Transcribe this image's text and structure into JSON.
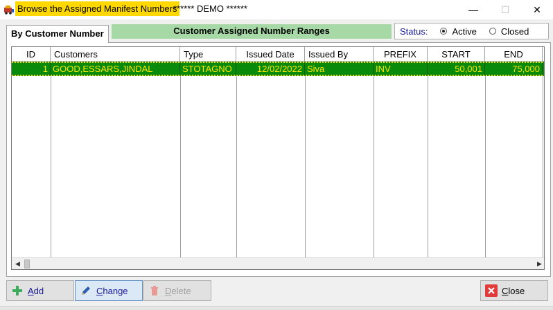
{
  "window": {
    "title": "Browse the Assigned Manifest Numbers",
    "subtitle": "****** DEMO ******",
    "minimize_glyph": "—",
    "maximize_glyph": "☐",
    "close_glyph": "✕"
  },
  "tab": {
    "label": "By Customer Number"
  },
  "banner": {
    "text": "Customer Assigned Number Ranges"
  },
  "status": {
    "label": "Status:",
    "options": [
      {
        "label": "Active",
        "checked": true
      },
      {
        "label": "Closed",
        "checked": false
      }
    ]
  },
  "grid": {
    "columns": [
      "ID",
      "Customers",
      "Type",
      "Issued Date",
      "Issued By",
      "PREFIX",
      "START",
      "END"
    ],
    "rows": [
      {
        "id": "1",
        "customers": "GOOD,ESSARS,JINDAL",
        "type": "STOTAGNO",
        "issued_date": "12/02/2022",
        "issued_by": "Siva",
        "prefix": "INV",
        "start": "50,001",
        "end": "75,000"
      }
    ],
    "selected_row_color": "#0a8a0a",
    "selected_text_color": "#ffe600"
  },
  "buttons": {
    "add": {
      "mnemonic": "A",
      "rest": "dd"
    },
    "change": {
      "mnemonic": "C",
      "rest": "hange"
    },
    "delete": {
      "mnemonic": "D",
      "rest": "elete"
    },
    "close": {
      "mnemonic": "C",
      "rest": "lose"
    }
  },
  "icons": [
    "app-icon",
    "plus-icon",
    "pencil-icon",
    "trash-icon",
    "close-x-icon"
  ]
}
